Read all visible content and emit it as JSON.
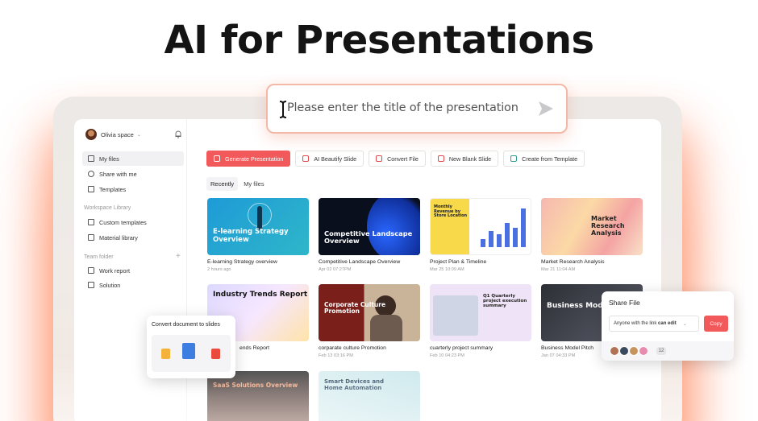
{
  "hero": {
    "title": "AI for Presentations"
  },
  "prompt": {
    "placeholder": "Please enter the title of the presentation"
  },
  "sidebar": {
    "space_name": "Olivia space",
    "items": [
      {
        "label": "My files",
        "icon": "file-icon",
        "active": true
      },
      {
        "label": "Share with me",
        "icon": "share-icon"
      },
      {
        "label": "Templates",
        "icon": "template-icon"
      }
    ],
    "workspace_library_title": "Workspace Library",
    "library_items": [
      {
        "label": "Custom templates",
        "icon": "template-icon"
      },
      {
        "label": "Material library",
        "icon": "image-icon"
      }
    ],
    "team_folder_title": "Team folder",
    "team_items": [
      {
        "label": "Work report",
        "icon": "folder-icon"
      },
      {
        "label": "Solution",
        "icon": "folder-icon"
      }
    ]
  },
  "toolbar": {
    "generate": "Generate Presentation",
    "beautify": "AI Beautify Slide",
    "convert": "Convert File",
    "blank": "New Blank Slide",
    "template": "Create from Template"
  },
  "tabs": {
    "recently": "Recently",
    "my_files": "My files"
  },
  "files": [
    {
      "title": "E-learning Strategy overview",
      "time": "2 hours ago",
      "thumb_text": "E-learning Strategy Overview"
    },
    {
      "title": "Competitive Landscape Overview",
      "time": "Apr 02 07:27PM",
      "thumb_text": "Competitive Landscape Overview"
    },
    {
      "title": "Project Plan & Timeline",
      "time": "Mar 25 10:09 AM",
      "thumb_text": "Monthly Revenue by Store Location"
    },
    {
      "title": "Market Research Analysis",
      "time": "Mar 21 11:04 AM",
      "thumb_text": "Market Research Analysis"
    },
    {
      "title": "Industry Trends Report",
      "time": "",
      "thumb_text": "Industry Trends Report"
    },
    {
      "title": "corparate culture Promotion",
      "time": "Feb 13 03:16 PM",
      "thumb_text": "Corporate Culture Promotion"
    },
    {
      "title": "cuarterly project summary",
      "time": "Feb 10 04:23 PM",
      "thumb_text": "Q1 Quarterly project execution summary"
    },
    {
      "title": "Business Model Pitch",
      "time": "Jan 07 04:33 PM",
      "thumb_text": "Business Model Pitch"
    },
    {
      "title": "",
      "time": "",
      "thumb_text": "SaaS Solutions Overview"
    },
    {
      "title": "",
      "time": "",
      "thumb_text": "Smart Devices and Home Automation"
    }
  ],
  "convert_popup": {
    "title": "Convert document to slides",
    "partial_label": "ends Report"
  },
  "share_popup": {
    "title": "Share File",
    "option": "Anyone with the link",
    "permission": "can edit",
    "copy": "Copy",
    "count": "12"
  },
  "colors": {
    "accent": "#f2595a",
    "glow": "#ff7a4a"
  }
}
